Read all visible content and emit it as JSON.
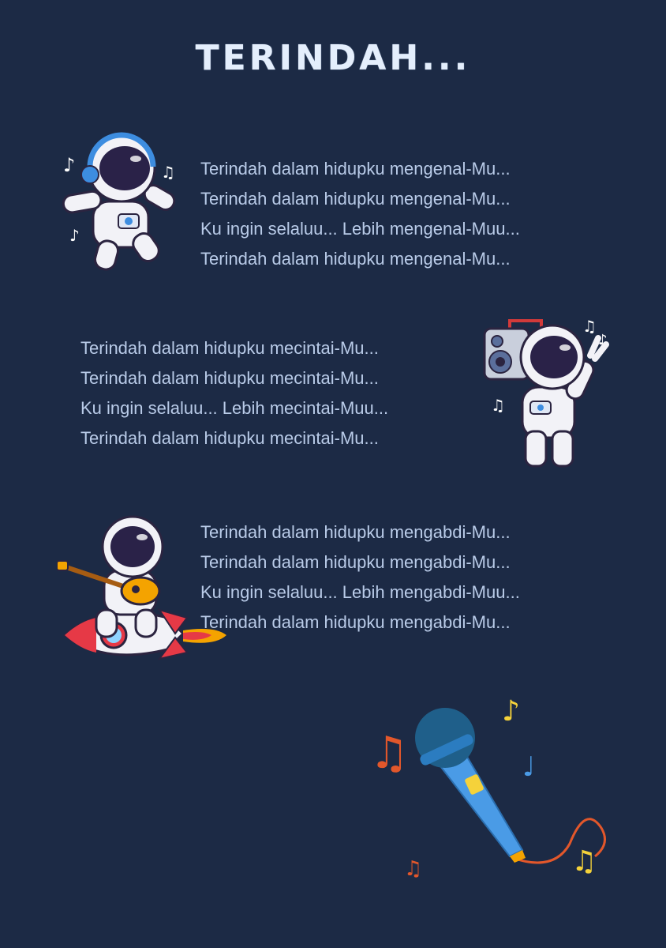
{
  "title": "TERINDAH...",
  "verses": [
    {
      "lines": [
        "Terindah dalam hidupku mengenal-Mu...",
        "Terindah dalam hidupku mengenal-Mu...",
        "Ku ingin selaluu... Lebih mengenal-Muu...",
        "Terindah dalam hidupku mengenal-Mu..."
      ]
    },
    {
      "lines": [
        "Terindah dalam hidupku mecintai-Mu...",
        "Terindah dalam hidupku mecintai-Mu...",
        "Ku ingin selaluu... Lebih mecintai-Muu...",
        "Terindah dalam hidupku mecintai-Mu..."
      ]
    },
    {
      "lines": [
        "Terindah dalam hidupku mengabdi-Mu...",
        "Terindah dalam hidupku mengabdi-Mu...",
        "Ku ingin selaluu... Lebih mengabdi-Muu...",
        "Terindah dalam hidupku mengabdi-Mu..."
      ]
    }
  ],
  "colors": {
    "background": "#1c2a45",
    "lyrics": "#b9cbe8",
    "title": "#e4eefc"
  },
  "icons": [
    "astronaut-headphones-icon",
    "astronaut-boombox-icon",
    "astronaut-guitar-rocket-icon",
    "microphone-icon"
  ]
}
